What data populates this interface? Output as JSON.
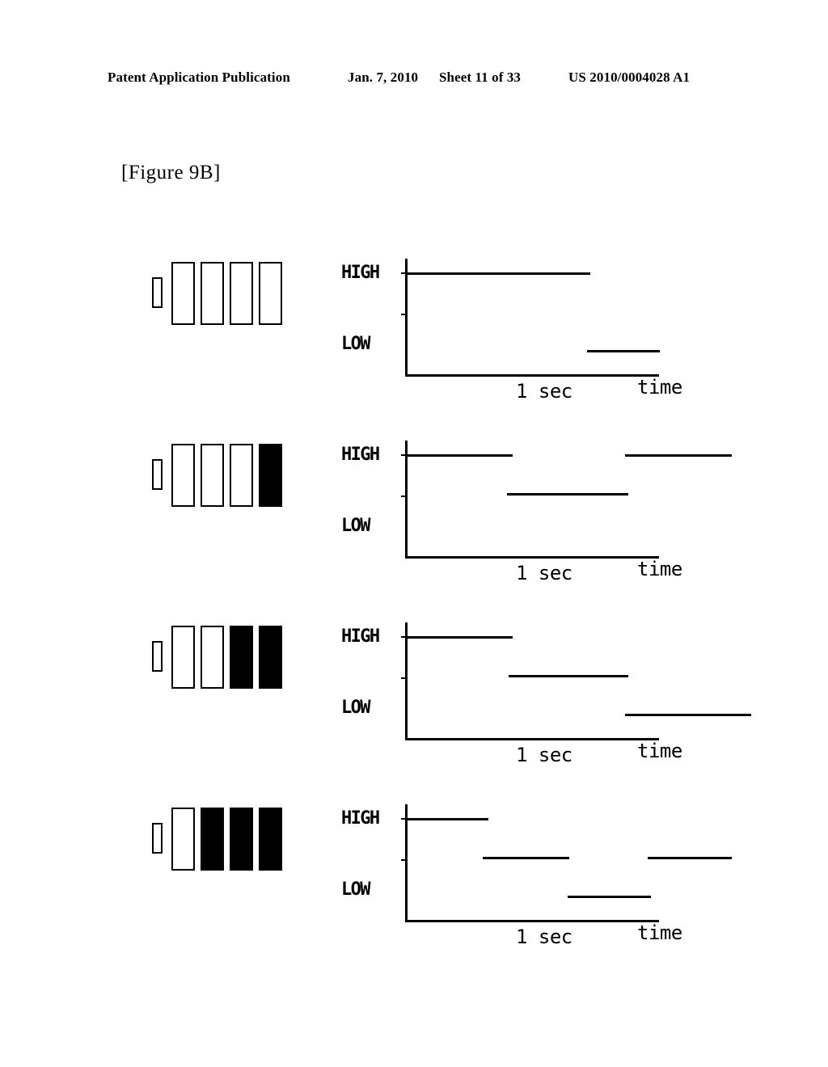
{
  "header": {
    "publication": "Patent Application Publication",
    "date": "Jan. 7, 2010",
    "sheet": "Sheet 11 of 33",
    "number": "US 2010/0004028 A1"
  },
  "figure": {
    "label": "[Figure 9B]"
  },
  "labels": {
    "high": "HIGH",
    "low": "LOW",
    "one_sec": "1 sec",
    "time": "time"
  },
  "chart_data": {
    "type": "line",
    "title": "[Figure 9B]",
    "xlabel": "time",
    "ylabel": "",
    "ytick_labels": [
      "HIGH",
      "LOW"
    ],
    "ytick_values": [
      1.0,
      0.35
    ],
    "xtick_labels": [
      "1 sec"
    ],
    "xtick_values": [
      1.0
    ],
    "xlim": [
      0,
      1.47
    ],
    "ylim": [
      0,
      1.12
    ],
    "grid": false,
    "legend": null,
    "note": "Four stepped signal-level traces; each is paired with a battery-style level indicator whose filled cell count increases 0,1,2,3 from top panel to bottom panel.",
    "panels": [
      {
        "index": 1,
        "indicator": {
          "terminal": true,
          "cells_total": 4,
          "cells_filled": 0,
          "cell_states": [
            "empty",
            "empty",
            "empty",
            "empty"
          ]
        },
        "series": [
          {
            "name": "signal",
            "steps": [
              {
                "x_start": 0.0,
                "x_end": 1.07,
                "level": "HIGH",
                "y": 1.0
              },
              {
                "x_start": 1.05,
                "x_end": 1.47,
                "level": "LOW",
                "y": 0.35
              }
            ]
          }
        ]
      },
      {
        "index": 2,
        "indicator": {
          "terminal": true,
          "cells_total": 4,
          "cells_filled": 1,
          "cell_states": [
            "empty",
            "empty",
            "empty",
            "filled"
          ]
        },
        "series": [
          {
            "name": "signal",
            "steps": [
              {
                "x_start": 0.0,
                "x_end": 0.62,
                "level": "HIGH",
                "y": 1.0
              },
              {
                "x_start": 0.59,
                "x_end": 1.29,
                "level": "MID",
                "y": 0.66
              },
              {
                "x_start": 1.27,
                "x_end": 1.89,
                "level": "HIGH",
                "y": 1.0
              }
            ]
          }
        ]
      },
      {
        "index": 3,
        "indicator": {
          "terminal": true,
          "cells_total": 4,
          "cells_filled": 2,
          "cell_states": [
            "empty",
            "empty",
            "filled",
            "filled"
          ]
        },
        "series": [
          {
            "name": "signal",
            "steps": [
              {
                "x_start": 0.0,
                "x_end": 0.62,
                "level": "HIGH",
                "y": 1.0
              },
              {
                "x_start": 0.6,
                "x_end": 1.29,
                "level": "MID",
                "y": 0.66
              },
              {
                "x_start": 1.27,
                "x_end": 2.0,
                "level": "LOW",
                "y": 0.35
              }
            ]
          }
        ]
      },
      {
        "index": 4,
        "indicator": {
          "terminal": true,
          "cells_total": 4,
          "cells_filled": 3,
          "cell_states": [
            "empty",
            "filled",
            "filled",
            "filled"
          ]
        },
        "series": [
          {
            "name": "signal",
            "steps": [
              {
                "x_start": 0.0,
                "x_end": 0.48,
                "level": "HIGH",
                "y": 1.0
              },
              {
                "x_start": 0.45,
                "x_end": 0.95,
                "level": "MID",
                "y": 0.66
              },
              {
                "x_start": 0.94,
                "x_end": 1.42,
                "level": "LOW",
                "y": 0.35
              },
              {
                "x_start": 1.4,
                "x_end": 1.89,
                "level": "MID",
                "y": 0.66
              }
            ]
          }
        ]
      }
    ]
  }
}
